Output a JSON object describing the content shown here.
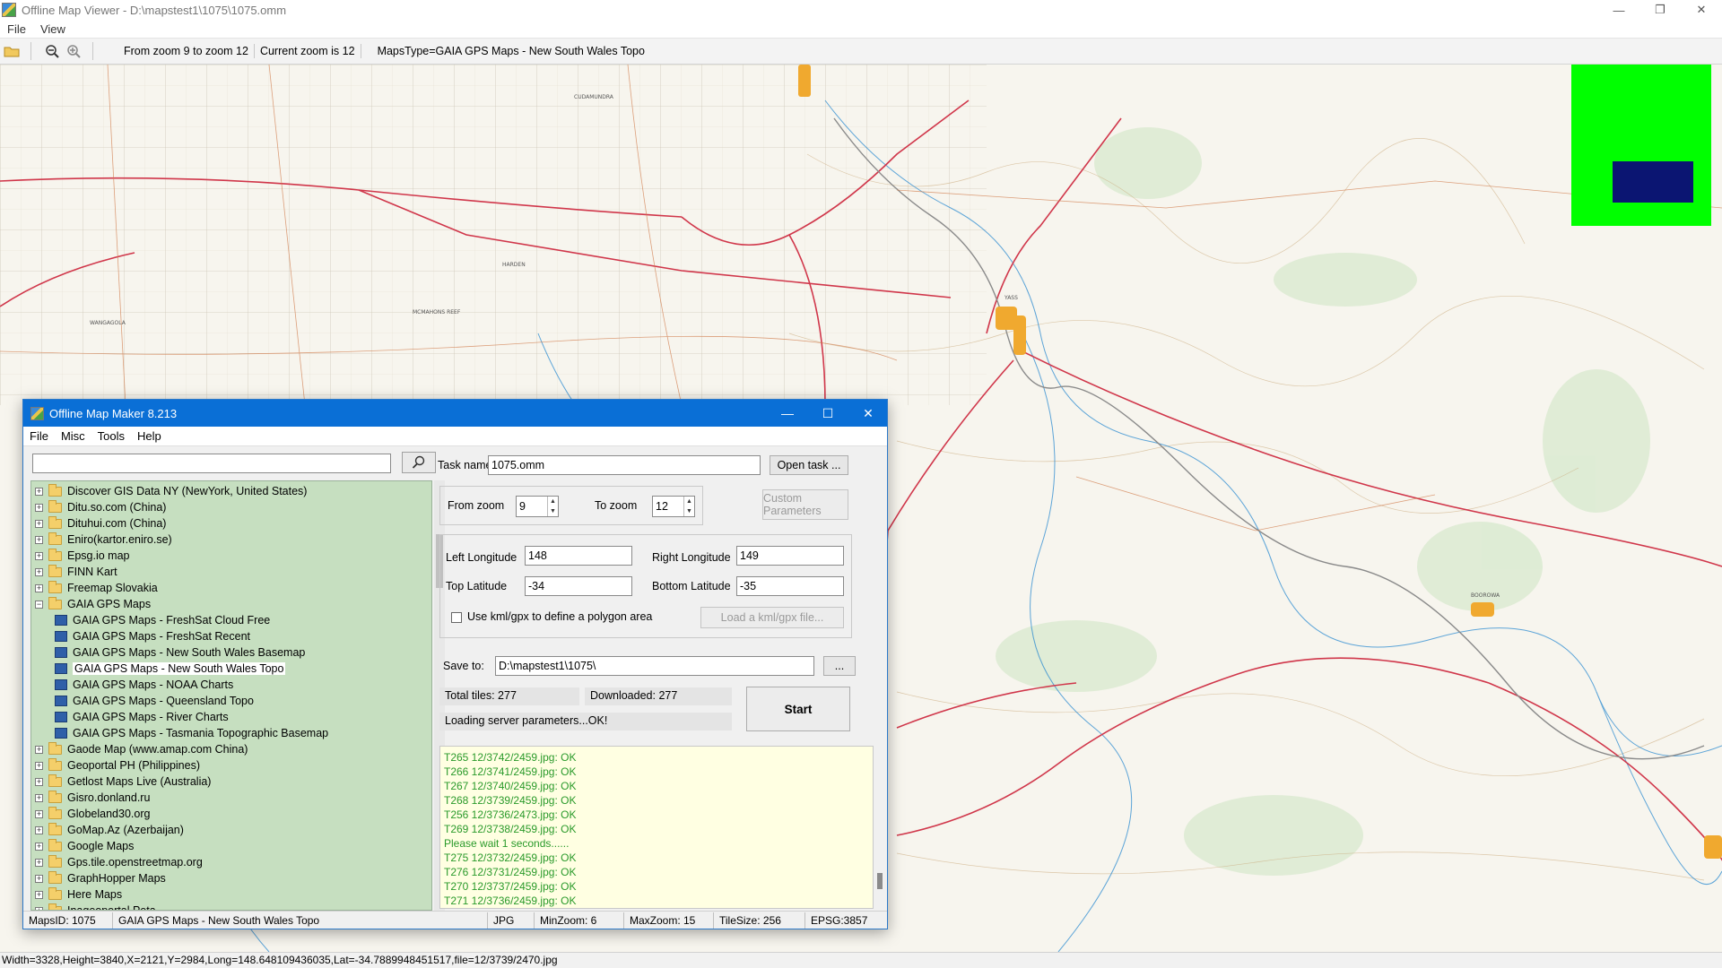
{
  "window": {
    "title": "Offline Map Viewer - D:\\mapstest1\\1075\\1075.omm",
    "menu": [
      "File",
      "View"
    ]
  },
  "toolbar": {
    "zoom_range": "From zoom 9 to zoom 12",
    "current_zoom": "Current zoom is 12",
    "maps_type": "MapsType=GAIA GPS Maps - New South Wales Topo"
  },
  "map": {
    "labels": [
      "CUDAMUNDRA",
      "HARDEN",
      "WANGAGOLA",
      "MCMAHONS REEF",
      "YASS",
      "BOOROWA"
    ],
    "overview_colors": {
      "background": "#00ff00",
      "viewport": "#0b1572"
    }
  },
  "statusbar": {
    "text": "Width=3328,Height=3840,X=2121,Y=2984,Long=148.648109436035,Lat=-34.7889948451517,file=12/3739/2470.jpg"
  },
  "dialog": {
    "title": "Offline Map Maker 8.213",
    "menu": [
      "File",
      "Misc",
      "Tools",
      "Help"
    ],
    "search_placeholder": "",
    "tree": [
      {
        "label": "Discover GIS Data NY (NewYork, United States)",
        "level": 0
      },
      {
        "label": "Ditu.so.com (China)",
        "level": 0
      },
      {
        "label": "Dituhui.com (China)",
        "level": 0
      },
      {
        "label": "Eniro(kartor.eniro.se)",
        "level": 0
      },
      {
        "label": "Epsg.io map",
        "level": 0
      },
      {
        "label": "FINN Kart",
        "level": 0
      },
      {
        "label": "Freemap Slovakia",
        "level": 0
      },
      {
        "label": "GAIA GPS Maps",
        "level": 0,
        "expanded": true
      },
      {
        "label": "GAIA GPS Maps - FreshSat Cloud Free",
        "level": 1
      },
      {
        "label": "GAIA GPS Maps - FreshSat Recent",
        "level": 1
      },
      {
        "label": "GAIA GPS Maps - New South Wales Basemap",
        "level": 1
      },
      {
        "label": "GAIA GPS Maps - New South Wales Topo",
        "level": 1,
        "selected": true
      },
      {
        "label": "GAIA GPS Maps - NOAA Charts",
        "level": 1
      },
      {
        "label": "GAIA GPS Maps - Queensland Topo",
        "level": 1
      },
      {
        "label": "GAIA GPS Maps - River Charts",
        "level": 1
      },
      {
        "label": "GAIA GPS Maps - Tasmania Topographic Basemap",
        "level": 1
      },
      {
        "label": "Gaode Map (www.amap.com China)",
        "level": 0
      },
      {
        "label": "Geoportal PH (Philippines)",
        "level": 0
      },
      {
        "label": "Getlost Maps Live (Australia)",
        "level": 0
      },
      {
        "label": "Gisro.donland.ru",
        "level": 0
      },
      {
        "label": "Globeland30.org",
        "level": 0
      },
      {
        "label": "GoMap.Az (Azerbaijan)",
        "level": 0
      },
      {
        "label": "Google Maps",
        "level": 0
      },
      {
        "label": "Gps.tile.openstreetmap.org",
        "level": 0
      },
      {
        "label": "GraphHopper Maps",
        "level": 0
      },
      {
        "label": "Here Maps",
        "level": 0
      },
      {
        "label": "Inageoportal Peta",
        "level": 0
      }
    ],
    "task": {
      "label": "Task name",
      "value": "1075.omm",
      "open_button": "Open task ..."
    },
    "zoom": {
      "from_label": "From zoom",
      "from_value": "9",
      "to_label": "To zoom",
      "to_value": "12",
      "custom_button": "Custom Parameters"
    },
    "bounds": {
      "left_lon_label": "Left Longitude",
      "left_lon": "148",
      "right_lon_label": "Right Longitude",
      "right_lon": "149",
      "top_lat_label": "Top Latitude",
      "top_lat": "-34",
      "bottom_lat_label": "Bottom Latitude",
      "bottom_lat": "-35"
    },
    "polygon": {
      "checkbox_label": "Use kml/gpx to define a polygon area",
      "checked": false,
      "load_button": "Load a kml/gpx file..."
    },
    "save": {
      "label": "Save to:",
      "value": "D:\\mapstest1\\1075\\",
      "browse_button": "..."
    },
    "progress": {
      "total_tiles": "Total tiles: 277",
      "downloaded": "Downloaded: 277",
      "status": "Loading server parameters...OK!",
      "start_button": "Start"
    },
    "log": [
      "T265 12/3742/2459.jpg: OK",
      "T266 12/3741/2459.jpg: OK",
      "T267 12/3740/2459.jpg: OK",
      "T268 12/3739/2459.jpg: OK",
      "T256 12/3736/2473.jpg: OK",
      "T269 12/3738/2459.jpg: OK",
      "Please wait 1 seconds......",
      "T275 12/3732/2459.jpg: OK",
      "T276 12/3731/2459.jpg: OK",
      "T270 12/3737/2459.jpg: OK",
      "T271 12/3736/2459.jpg: OK"
    ],
    "status": {
      "maps_id": "MapsID: 1075",
      "maps_name": "GAIA GPS Maps - New South Wales Topo",
      "format": "JPG",
      "min_zoom": "MinZoom: 6",
      "max_zoom": "MaxZoom: 15",
      "tile_size": "TileSize: 256",
      "epsg": "EPSG:3857"
    }
  }
}
